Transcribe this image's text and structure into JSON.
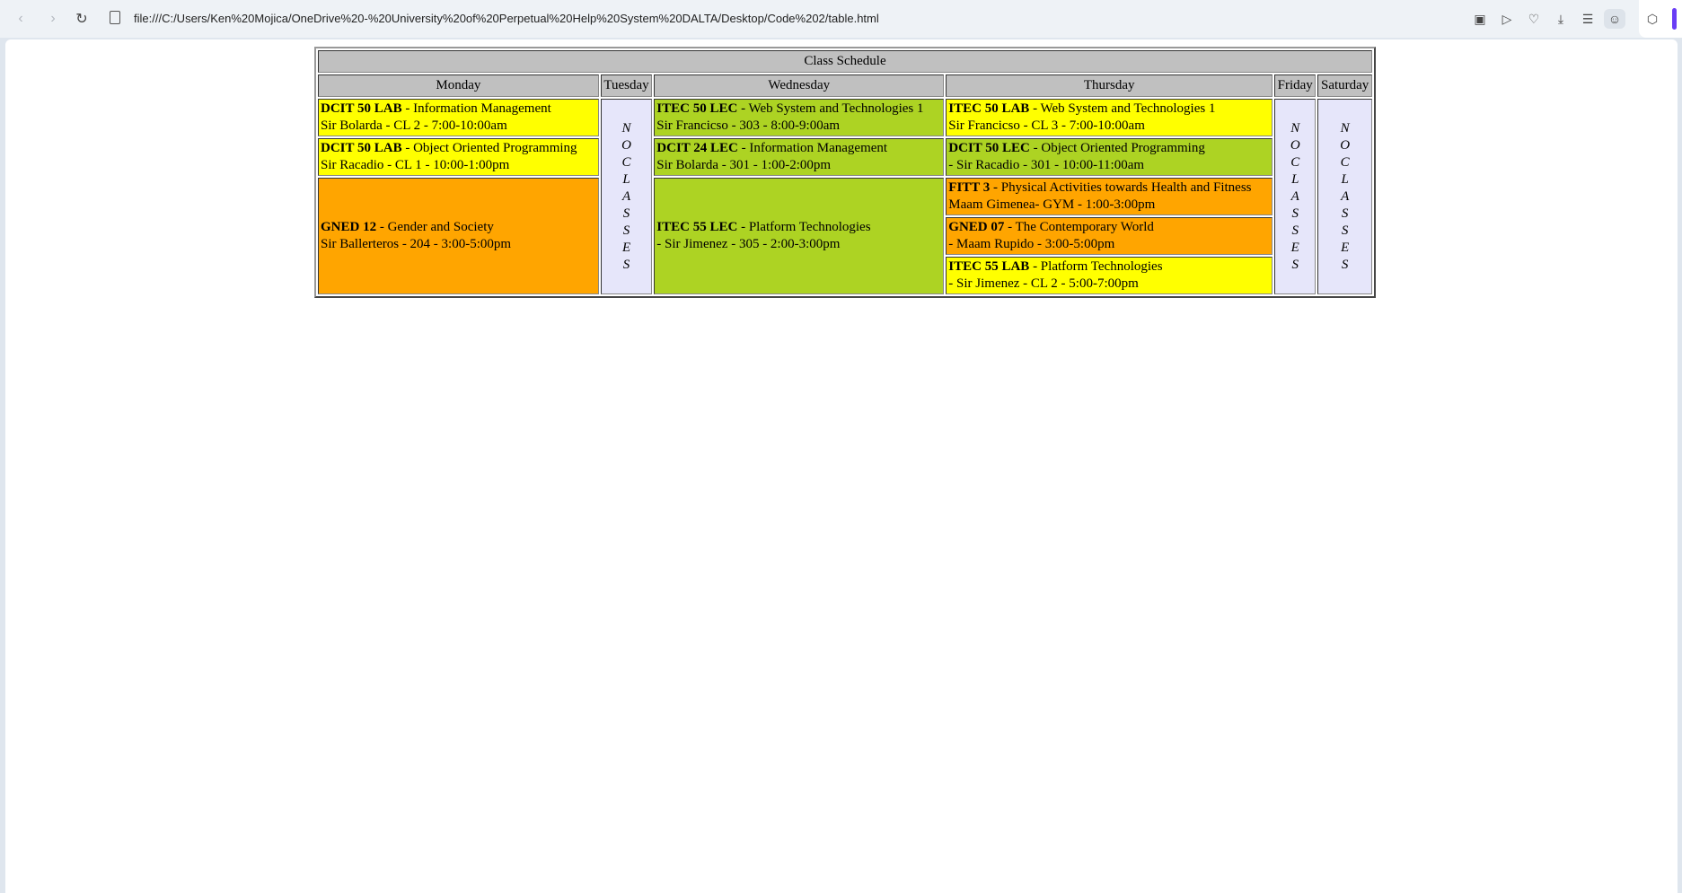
{
  "browser": {
    "url": "file:///C:/Users/Ken%20Mojica/OneDrive%20-%20University%20of%20Perpetual%20Help%20System%20DALTA/Desktop/Code%202/table.html",
    "icons": [
      "back-icon",
      "forward-icon",
      "reload-icon",
      "page-icon",
      "camera-icon",
      "play-icon",
      "heart-icon",
      "download-icon",
      "menu-icon",
      "profile-icon",
      "cube-icon"
    ]
  },
  "schedule": {
    "caption": "Class Schedule",
    "days": [
      "Monday",
      "Tuesday",
      "Wednesday",
      "Thursday",
      "Friday",
      "Saturday"
    ],
    "no_classes_letters": [
      "N",
      "O",
      "C",
      "L",
      "A",
      "S",
      "S",
      "E",
      "S"
    ],
    "monday": [
      {
        "code": "DCIT 50 LAB",
        "title": " - Information Management",
        "detail": "Sir Bolarda - CL 2 - 7:00-10:00am",
        "color": "#ffff00"
      },
      {
        "code": "DCIT 50 LAB",
        "title": " - Object Oriented Programming",
        "detail": "Sir Racadio - CL 1 - 10:00-1:00pm",
        "color": "#ffff00"
      },
      {
        "code": "GNED 12",
        "title": " - Gender and Society",
        "detail": "Sir Ballerteros - 204 - 3:00-5:00pm",
        "color": "#ffa500"
      }
    ],
    "wednesday": [
      {
        "code": "ITEC 50 LEC",
        "title": " - Web System and Technologies 1",
        "detail": "Sir Francicso - 303 - 8:00-9:00am",
        "color": "#add323"
      },
      {
        "code": "DCIT 24 LEC",
        "title": " - Information Management",
        "detail": "Sir Bolarda - 301 - 1:00-2:00pm",
        "color": "#add323"
      },
      {
        "code": "ITEC 55 LEC",
        "title": " - Platform Technologies",
        "detail": "- Sir Jimenez - 305 - 2:00-3:00pm",
        "color": "#add323"
      }
    ],
    "thursday": [
      {
        "code": "ITEC 50 LAB",
        "title": " - Web System and Technologies 1",
        "detail": "Sir Francicso - CL 3 - 7:00-10:00am",
        "color": "#ffff00"
      },
      {
        "code": "DCIT 50 LEC",
        "title": " - Object Oriented Programming",
        "detail": "- Sir Racadio - 301 - 10:00-11:00am",
        "color": "#add323"
      },
      {
        "code": "FITT 3",
        "title": " - Physical Activities towards Health and Fitness",
        "detail": "Maam Gimenea- GYM - 1:00-3:00pm",
        "color": "#ffa500"
      },
      {
        "code": "GNED 07",
        "title": " - The Contemporary World",
        "detail": "- Maam Rupido - 3:00-5:00pm",
        "color": "#ffa500"
      },
      {
        "code": "ITEC 55 LAB",
        "title": " - Platform Technologies",
        "detail": "- Sir Jimenez - CL 2 - 5:00-7:00pm",
        "color": "#ffff00"
      }
    ]
  }
}
